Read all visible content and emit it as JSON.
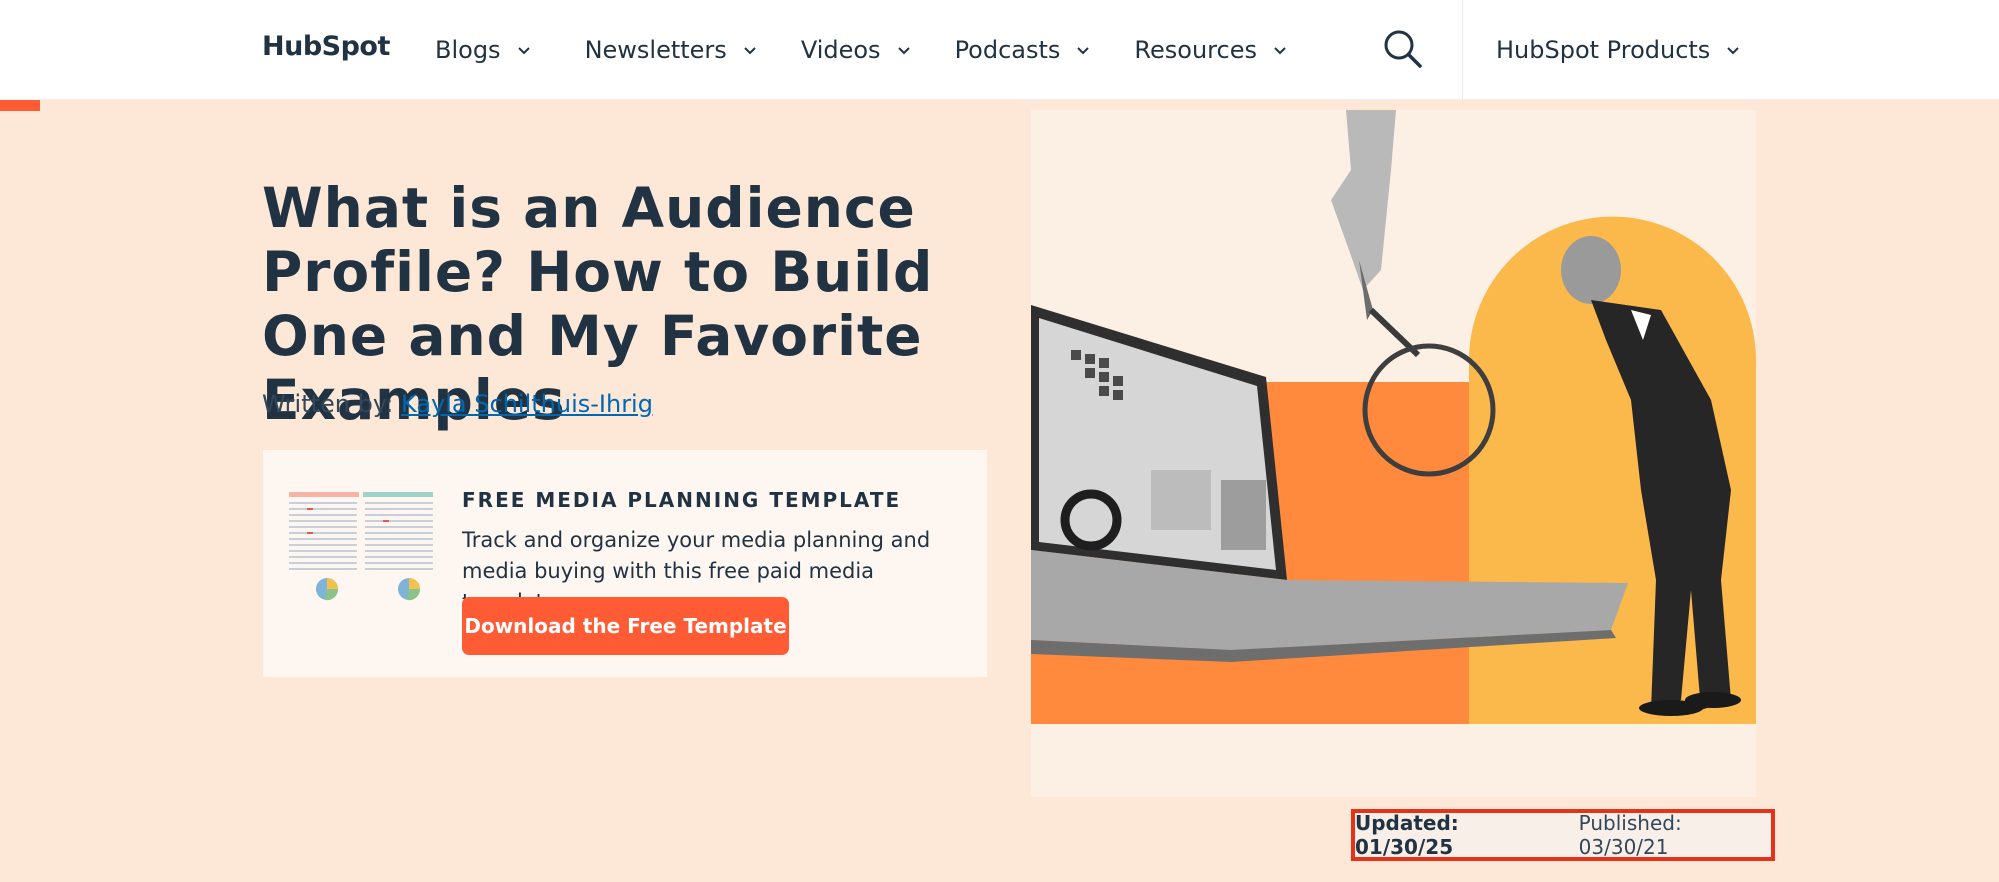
{
  "header": {
    "logo_text": "HubSpot",
    "nav": [
      {
        "label": "Blogs",
        "icon": "chevron-down-icon"
      },
      {
        "label": "Newsletters",
        "icon": "chevron-down-icon"
      },
      {
        "label": "Videos",
        "icon": "chevron-down-icon"
      },
      {
        "label": "Podcasts",
        "icon": "chevron-down-icon"
      },
      {
        "label": "Resources",
        "icon": "chevron-down-icon"
      }
    ],
    "search_icon": "search-icon",
    "products_label": "HubSpot Products"
  },
  "article": {
    "title": "What is an Audience Profile? How to Build One and My Favorite Examples",
    "byline_prefix": "Written by:",
    "author": "Kayla Schilthuis-Ihrig"
  },
  "offer": {
    "kicker": "FREE MEDIA PLANNING TEMPLATE",
    "description": "Track and organize your media planning and media buying with this free paid media template.",
    "cta_label": "Download the Free Template"
  },
  "dates": {
    "updated": "Updated: 01/30/25",
    "published": "Published: 03/30/21"
  },
  "colors": {
    "accent": "#ff5c35",
    "text": "#213343",
    "link": "#0068b1",
    "hero_bg": "#fde8d7",
    "highlight_border": "#e4321b"
  }
}
